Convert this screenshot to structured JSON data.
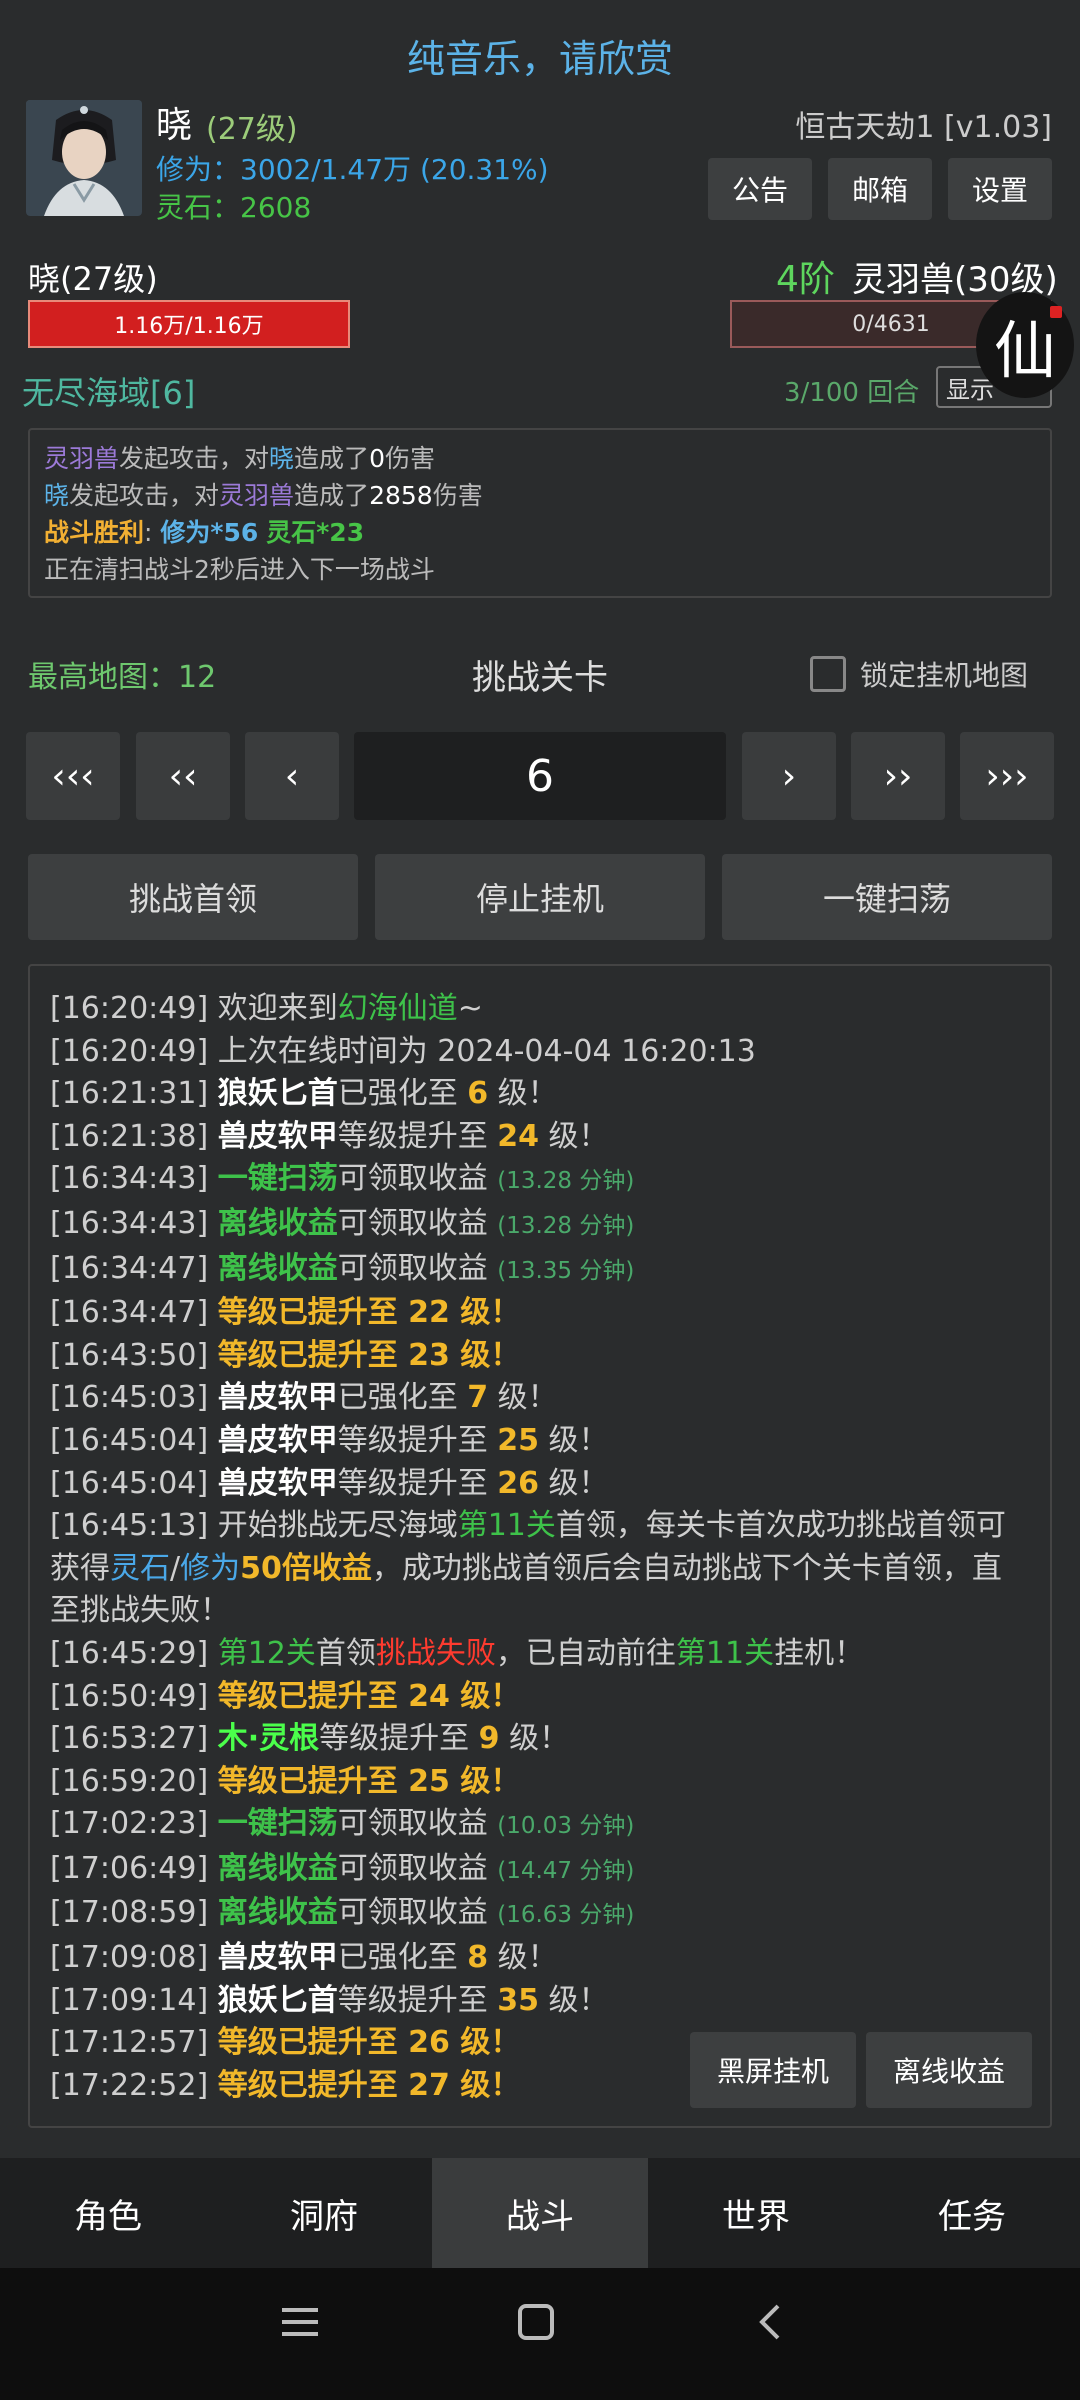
{
  "header": {
    "music_banner": "纯音乐，请欣赏",
    "player_name": "晓",
    "player_level": "(27级)",
    "cultivation_label": "修为：",
    "cultivation_value": "3002/1.47万 (20.31%)",
    "spirit_stone_label": "灵石：",
    "spirit_stone_value": "2608",
    "server_name": "恒古天劫1 [v1.03]",
    "buttons": {
      "announcement": "公告",
      "mailbox": "邮箱",
      "settings": "设置"
    }
  },
  "battle": {
    "player": {
      "name": "晓(27级)",
      "hp_text": "1.16万/1.16万",
      "hp_fraction": 1.0
    },
    "enemy": {
      "stage": "4阶",
      "name": "灵羽兽(30级)",
      "hp_text": "0/4631",
      "hp_fraction": 0.0
    },
    "badge": "仙",
    "region": "无尽海域[6]",
    "round": "3/100 回合",
    "display_toggle": "显示",
    "log": {
      "line1": {
        "actor": "灵羽兽",
        "t1": "发起攻击，对",
        "target": "晓",
        "t2": "造成了",
        "dmg": "0",
        "t3": "伤害"
      },
      "line2": {
        "actor": "晓",
        "t1": "发起攻击，对",
        "target": "灵羽兽",
        "t2": "造成了",
        "dmg": "2858",
        "t3": "伤害"
      },
      "line3": {
        "label": "战斗胜利",
        "colon": ":",
        "reward1": "修为*56",
        "reward2": "灵石*23"
      },
      "line4": "正在清扫战斗2秒后进入下一场战斗"
    }
  },
  "challenge": {
    "max_map": "最高地图：12",
    "title": "挑战关卡",
    "lock_label": "锁定挂机地图",
    "nav": {
      "first": "‹‹‹",
      "prev10": "‹‹",
      "prev": "‹",
      "next": "›",
      "next10": "››",
      "last": "›››"
    },
    "current_level": "6",
    "actions": {
      "boss": "挑战首领",
      "stop": "停止挂机",
      "sweep": "一键扫荡"
    }
  },
  "system_log": {
    "l1": {
      "time": "[16:20:49]",
      "text": " 欢迎来到",
      "hl": "幻海仙道",
      "tail": "~"
    },
    "l2": {
      "time": "[16:20:49]",
      "text": " 上次在线时间为 2024-04-04 16:20:13"
    },
    "l3": {
      "time": "[16:21:31]",
      "item": "狼妖匕首",
      "text": "已强化至 ",
      "num": "6",
      "tail": " 级！"
    },
    "l4": {
      "time": "[16:21:38]",
      "item": "兽皮软甲",
      "text": "等级提升至 ",
      "num": "24",
      "tail": " 级！"
    },
    "l5": {
      "time": "[16:34:43]",
      "item": "一键扫荡",
      "text": "可领取收益 ",
      "note": "(13.28 分钟)"
    },
    "l6": {
      "time": "[16:34:43]",
      "item": "离线收益",
      "text": "可领取收益 ",
      "note": "(13.28 分钟)"
    },
    "l7": {
      "time": "[16:34:47]",
      "item": "离线收益",
      "text": "可领取收益 ",
      "note": "(13.35 分钟)"
    },
    "l8": {
      "time": "[16:34:47]",
      "text": "等级已提升至 22 级！"
    },
    "l9": {
      "time": "[16:43:50]",
      "text": "等级已提升至 23 级！"
    },
    "l10": {
      "time": "[16:45:03]",
      "item": "兽皮软甲",
      "text": "已强化至 ",
      "num": "7",
      "tail": " 级！"
    },
    "l11": {
      "time": "[16:45:04]",
      "item": "兽皮软甲",
      "text": "等级提升至 ",
      "num": "25",
      "tail": " 级！"
    },
    "l12": {
      "time": "[16:45:04]",
      "item": "兽皮软甲",
      "text": "等级提升至 ",
      "num": "26",
      "tail": " 级！"
    },
    "l13": {
      "time": "[16:45:13]",
      "t1": " 开始挑战无尽海域",
      "stage": "第11关",
      "t2": "首领，每关卡首次成功挑战首领可获得",
      "stone": "灵石",
      "slash": "/",
      "cult": "修为",
      "bonus": "50倍收益",
      "t3": "，成功挑战首领后会自动挑战下个关卡首领，直至挑战失败！"
    },
    "l14": {
      "time": "[16:45:29]",
      "stage": "第12关",
      "t1": "首领",
      "fail": "挑战失败",
      "t2": "，已自动前往",
      "stage2": "第11关",
      "t3": "挂机！"
    },
    "l15": {
      "time": "[16:50:49]",
      "text": "等级已提升至 24 级！"
    },
    "l16": {
      "time": "[16:53:27]",
      "item": "木·灵根",
      "text": "等级提升至 ",
      "num": "9",
      "tail": " 级！"
    },
    "l17": {
      "time": "[16:59:20]",
      "text": "等级已提升至 25 级！"
    },
    "l18": {
      "time": "[17:02:23]",
      "item": "一键扫荡",
      "text": "可领取收益 ",
      "note": "(10.03 分钟)"
    },
    "l19": {
      "time": "[17:06:49]",
      "item": "离线收益",
      "text": "可领取收益 ",
      "note": "(14.47 分钟)"
    },
    "l20": {
      "time": "[17:08:59]",
      "item": "离线收益",
      "text": "可领取收益 ",
      "note": "(16.63 分钟)"
    },
    "l21": {
      "time": "[17:09:08]",
      "item": "兽皮软甲",
      "text": "已强化至 ",
      "num": "8",
      "tail": " 级！"
    },
    "l22": {
      "time": "[17:09:14]",
      "item": "狼妖匕首",
      "text": "等级提升至 ",
      "num": "35",
      "tail": " 级！"
    },
    "l23": {
      "time": "[17:12:57]",
      "text": "等级已提升至 26 级！"
    },
    "l24": {
      "time": "[17:22:52]",
      "text": "等级已提升至 27 级！"
    },
    "buttons": {
      "black_screen": "黑屏挂机",
      "offline": "离线收益"
    }
  },
  "tabs": [
    "角色",
    "洞府",
    "战斗",
    "世界",
    "任务"
  ],
  "active_tab": "战斗",
  "colors": {
    "accent_blue": "#5cb3e8",
    "gold": "#f2b82a",
    "green": "#3ec24a",
    "red_hp": "#d21f1f"
  },
  "system_nav_icons": [
    "menu-icon",
    "home-square-icon",
    "back-chevron-icon"
  ]
}
